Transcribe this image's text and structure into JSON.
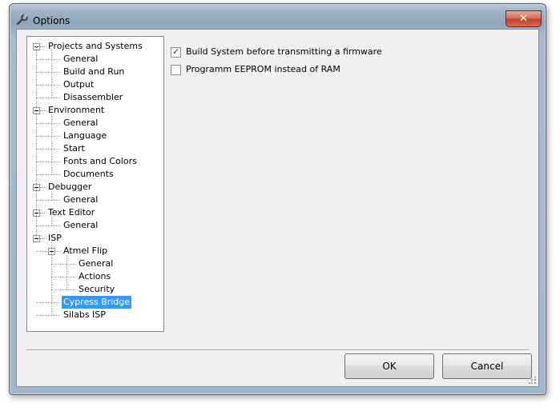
{
  "window": {
    "title": "Options",
    "close_label": "✕"
  },
  "tree": {
    "nodes": [
      {
        "label": "Projects and Systems",
        "level": 0,
        "expanded": true
      },
      {
        "label": "General",
        "level": 1
      },
      {
        "label": "Build and Run",
        "level": 1
      },
      {
        "label": "Output",
        "level": 1
      },
      {
        "label": "Disassembler",
        "level": 1
      },
      {
        "label": "Environment",
        "level": 0,
        "expanded": true
      },
      {
        "label": "General",
        "level": 1
      },
      {
        "label": "Language",
        "level": 1
      },
      {
        "label": "Start",
        "level": 1
      },
      {
        "label": "Fonts and Colors",
        "level": 1
      },
      {
        "label": "Documents",
        "level": 1
      },
      {
        "label": "Debugger",
        "level": 0,
        "expanded": true
      },
      {
        "label": "General",
        "level": 1
      },
      {
        "label": "Text Editor",
        "level": 0,
        "expanded": true
      },
      {
        "label": "General",
        "level": 1
      },
      {
        "label": "ISP",
        "level": 0,
        "expanded": true
      },
      {
        "label": "Atmel Flip",
        "level": 1,
        "expanded": true
      },
      {
        "label": "General",
        "level": 2
      },
      {
        "label": "Actions",
        "level": 2
      },
      {
        "label": "Security",
        "level": 2
      },
      {
        "label": "Cypress Bridge",
        "level": 1,
        "selected": true
      },
      {
        "label": "Silabs ISP",
        "level": 1
      }
    ]
  },
  "options": [
    {
      "label": "Build System before transmitting a firmware",
      "checked": true
    },
    {
      "label": "Programm EEPROM instead of RAM",
      "checked": false
    }
  ],
  "buttons": {
    "ok": "OK",
    "cancel": "Cancel"
  },
  "colors": {
    "selection": "#3399ff",
    "close": "#c1412b"
  }
}
